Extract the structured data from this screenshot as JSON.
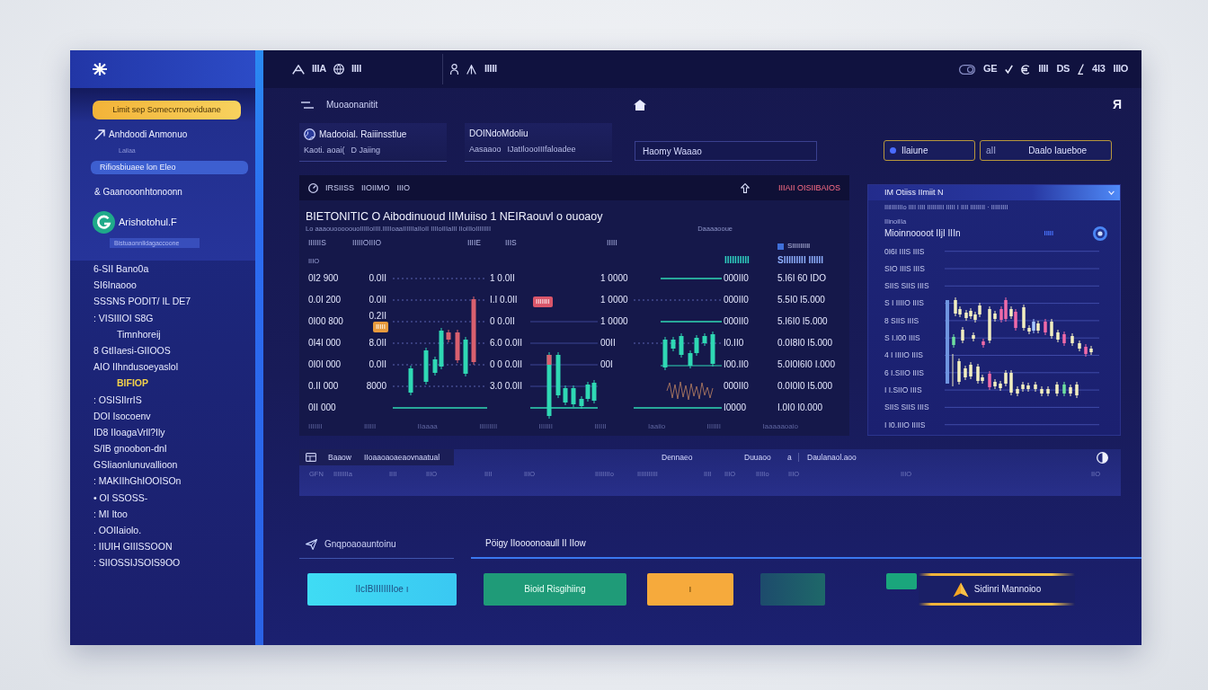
{
  "sidebar": {
    "primary_action": "Limit sep Somecvrnoeviduane",
    "nav": [
      {
        "label": "Anhdoodi Anmonuo",
        "selected": false,
        "note": "Lailaa"
      },
      {
        "label": "Rifiosbiuaee lon Eleo",
        "selected": true
      },
      {
        "label": "& Gaanooonhtonoonn",
        "selected": false
      }
    ],
    "profile": {
      "name": "Arishotohul.F",
      "subtitle": "Bistuaonnlldagaccoone"
    },
    "menu": [
      {
        "label": "6-SII Bano0a",
        "selected": false
      },
      {
        "label": "SI6Inaooo",
        "selected": false
      },
      {
        "label": "SSSNS PODIT/ IL DE7",
        "selected": false
      },
      {
        "label": ": VISIIIOI S8G",
        "selected": false,
        "children": [
          {
            "label": "Timnhoreij",
            "selected": false
          }
        ]
      },
      {
        "label": "8 GtIIaesi-GIIOOS",
        "selected": false
      },
      {
        "label": "AIO IIhndusoeyaslol",
        "selected": false,
        "children": [
          {
            "label": "BIFIOP",
            "selected": true
          }
        ]
      },
      {
        "label": ": OSISIIrrIS",
        "selected": false
      },
      {
        "label": "DOI Isocoenv",
        "selected": false
      },
      {
        "label": "ID8 IIoagaVrll?Ily",
        "selected": false
      },
      {
        "label": "S/IB gnoobon-dnI",
        "selected": false
      },
      {
        "label": "GSIiaonlunuvallioon",
        "selected": false
      },
      {
        "label": ": MAKIIhGhIOOISOn",
        "selected": false
      },
      {
        "label": "• OI SSOSS-",
        "selected": false
      },
      {
        "label": ": MI Itoo",
        "selected": false
      },
      {
        "label": ". OOIIaiolo.",
        "selected": false
      },
      {
        "label": ": IIUIH GIIISSOON",
        "selected": false
      },
      {
        "label": ": SIIOSSIJSOIS9OO",
        "selected": false
      }
    ]
  },
  "top_bar": {
    "left_labels": [
      "IIIA",
      "IIII"
    ],
    "middle_label": "IIIII",
    "right_labels": [
      "GE",
      "IIII",
      "DS",
      "4I3",
      "IIIO"
    ]
  },
  "sub_bar": {
    "breadcrumb": "Muoaonanitit",
    "profile_initial": "Я"
  },
  "summary_cards": [
    {
      "title": "Madooial. Raiiinsstlue",
      "lines": [
        "Kaoti. aoai(",
        "D Jaiing"
      ]
    },
    {
      "title": "DOINdoMdoliu",
      "lines": [
        "Aasaaoo",
        "IJatIloooIIIfaloadee"
      ]
    }
  ],
  "search": {
    "value": "Haomy Waaao"
  },
  "filters": [
    {
      "label": "Ilaiune"
    },
    {
      "prefix": "aII",
      "label": "Daalo Iaueboe"
    }
  ],
  "chart_panel": {
    "header": {
      "items": [
        "IRSIISS",
        "IIOIIMO",
        "IIIO"
      ],
      "action": "IIIAII OISIIBAIOS"
    },
    "title": "BIETONITIC O Aibodinuoud IIMuiiso  1 NEIRaouvl o ouoaoy",
    "subtitle": "Lo aaaouooooouoIIIIIoIIII.lIIIIoaaIIIIIIaIIoII IIIIoIIIaIII IIoIIIoIIIIIIII",
    "note": "Daaaaooue",
    "column_heads": [
      "IIIIIIS",
      "IIIIIOIIIO",
      "IIIIE",
      "IIIS",
      "IIIII"
    ],
    "unit": "IIIO",
    "legend": [
      {
        "kind": "swatch",
        "label": "SIIIIIIIII",
        "color": "#3f6fd8"
      },
      {
        "kind": "text",
        "label": "IIIIIIIIII",
        "color": "#2fd2c2"
      },
      {
        "kind": "text",
        "label": "SIIIIIIIII IIIIII",
        "color": "#8fb0ff"
      }
    ],
    "badges": [
      {
        "label": "IIIIIII",
        "color": "#d9566a"
      },
      {
        "label": "IIIII",
        "color": "#e89a3c"
      }
    ],
    "rows": [
      {
        "column_1": "0I2 900",
        "column_2": "0.0II",
        "column_3": "1 0.0II",
        "column_4": "1 0000",
        "column_5": "000II0",
        "column_6": "5.I6I 60 IDO"
      },
      {
        "column_1": "0.0I 200",
        "column_2": "0.0II",
        "column_3": "I.I 0.0II",
        "column_4": "1 0000",
        "column_5": "000II0",
        "column_6": "5.5I0 I5.000"
      },
      {
        "column_1": "0I00 800",
        "column_2": "0.2II",
        "column_3": "0 0.0II",
        "column_4": "1 0000",
        "column_5": "000II0",
        "column_6": "5.I6I0 I5.000"
      },
      {
        "column_1": "0I4I 000",
        "column_2": "8.0II",
        "column_3": "6.0 0.0II",
        "column_4": "00II",
        "column_5": "I0.II0",
        "column_6": "0.0I8I0 I5.000"
      },
      {
        "column_1": "0I0I 000",
        "column_2": "0.0II",
        "column_3": "0 0 0.0II",
        "column_4": "00I",
        "column_5": "I00.II0",
        "column_6": "5.0I0I6I0 I.000"
      },
      {
        "column_1": "0.II 000",
        "column_2": "8000",
        "column_3": "3.0 0.0II",
        "column_5": "000II0",
        "column_6": "0.0I0I0 I5.000"
      },
      {
        "column_1": "0II 000",
        "column_5": "I0000",
        "column_6": "I.0I0 I0.000"
      }
    ],
    "footer": [
      "IIIIIII",
      "IIIIII",
      "IIaaaa",
      "IIIIIIIII",
      "IIIIIII",
      "IIIIII",
      "Iaaiio",
      "IIIIIII",
      "Iaaaaaoaio"
    ]
  },
  "side_chart": {
    "title": "IM Otiiss IImiit N",
    "subtitle": "IIiIIIIIIIo IIII IIII IIIIIIIII IIIII I IIII IIIIIIII · IIIIIIIII",
    "label": "IIinoiIIa",
    "heading": "Mioinnoooot IIjI IIIn",
    "tag": "IIIII",
    "rows": [
      "0I6I IIIS IIIS",
      "SIO IIIS IIIS",
      "SIIS SIIS IIIS",
      "S I IIIIO IIIS",
      "8 SIIS IIIS",
      "S I.I00 IIIS",
      "4 I IIIIO IIIS",
      "6 I.SIIO IIIS",
      "I I.SIIO IIIS",
      "SIIS SIIS IIIS",
      "I I0.IIIO IIIIS"
    ]
  },
  "data_strip": {
    "headings": [
      "Baaow",
      "IIoaaoaoaeaovnaatual",
      "Dennaeo",
      "Duuaoo",
      "a",
      "Daulanaol.aoo"
    ],
    "details": [
      "GFN",
      "IIIIIIIIa",
      "IIII",
      "IIIO",
      "IIII",
      "IIIO",
      "IIIIIIIIo",
      "IIIIIIIIIII",
      "IIII",
      "IIIO",
      "IIIIIo",
      "IIIO",
      "IIIO",
      "IIO"
    ]
  },
  "bottom_tabs": [
    {
      "label": "Gnqpoaoauntoinu",
      "selected": false
    },
    {
      "label": "Pöigy IIoooonoaull II IIow",
      "selected": true
    }
  ],
  "actions": [
    {
      "kind": "info",
      "label": "IIcIBIIIIIIIIoe ı"
    },
    {
      "kind": "success",
      "label": "Bioid Risgihiing"
    },
    {
      "kind": "warning",
      "label": "ı"
    },
    {
      "kind": "muted"
    },
    {
      "kind": "accent",
      "label": "Sidinri Mannoioo"
    }
  ]
}
